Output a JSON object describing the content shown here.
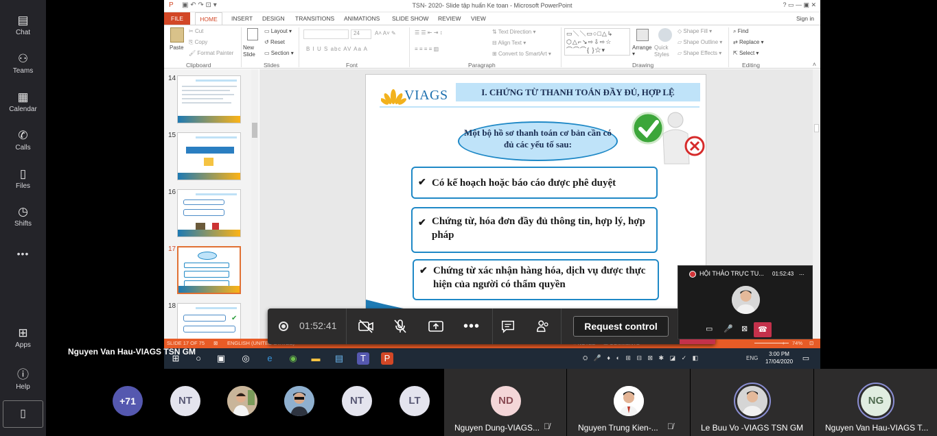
{
  "rail": {
    "items": [
      {
        "label": "Chat",
        "icon": "chat-icon",
        "glyph": "▤"
      },
      {
        "label": "Teams",
        "icon": "teams-icon",
        "glyph": "⚇"
      },
      {
        "label": "Calendar",
        "icon": "calendar-icon",
        "glyph": "▦"
      },
      {
        "label": "Calls",
        "icon": "phone-icon",
        "glyph": "✆"
      },
      {
        "label": "Files",
        "icon": "file-icon",
        "glyph": "▯"
      },
      {
        "label": "Shifts",
        "icon": "clock-icon",
        "glyph": "◷"
      },
      {
        "label": "",
        "icon": "more-icon",
        "glyph": "•••"
      }
    ],
    "apps": "Apps",
    "help": "Help"
  },
  "ppt": {
    "title": "TSN- 2020- Slide tập huấn Ke toan - Microsoft PowerPoint",
    "window_buttons": "?   ▭   —   ▣   ✕",
    "sign_in": "Sign in",
    "tabs": [
      "FILE",
      "HOME",
      "INSERT",
      "DESIGN",
      "TRANSITIONS",
      "ANIMATIONS",
      "SLIDE SHOW",
      "REVIEW",
      "VIEW"
    ],
    "groups": [
      "Clipboard",
      "Slides",
      "Font",
      "Paragraph",
      "Drawing",
      "Editing"
    ],
    "clipboard": {
      "paste": "Paste",
      "cut": "Cut",
      "copy": "Copy",
      "format_painter": "Format Painter"
    },
    "slides": {
      "new_slide": "New Slide",
      "layout": "Layout",
      "reset": "Reset",
      "section": "Section"
    },
    "font": {
      "size": "24",
      "buttons": "B  I  U  S  abc  AV  Aa  A"
    },
    "paragraph": {
      "text_direction": "Text Direction",
      "align_text": "Align Text",
      "smartart": "Convert to SmartArt"
    },
    "drawing": {
      "arrange": "Arrange",
      "quick_styles": "Quick Styles",
      "shape_fill": "Shape Fill",
      "shape_outline": "Shape Outline",
      "shape_effects": "Shape Effects"
    },
    "editing": {
      "find": "Find",
      "replace": "Replace",
      "select": "Select"
    },
    "thumb_numbers": [
      "14",
      "15",
      "16",
      "17",
      "18"
    ],
    "status": {
      "slide": "SLIDE 17 OF 75",
      "lang": "ENGLISH (UNITED STATES)",
      "notes": "NOTES",
      "comments": "COMMENTS",
      "zoom": "74%"
    }
  },
  "slide": {
    "logo": "VIAGS",
    "header": "I. CHỨNG TỪ THANH TOÁN ĐẦY ĐỦ, HỢP LỆ",
    "oval": "Một bộ hồ sơ thanh toán cơ bản cần có đủ các yếu tố sau:",
    "items": [
      "Có kế hoạch hoặc báo cáo được phê duyệt",
      "Chứng từ, hóa đơn đầy đủ thông tin, hợp lý, hợp pháp",
      "Chứng từ xác nhận hàng hóa, dịch vụ được thực hiện của người có thẩm quyền"
    ]
  },
  "taskbar": {
    "time": "3:00 PM",
    "date": "17/04/2020",
    "lang": "ENG"
  },
  "controls": {
    "timer": "01:52:41",
    "request_control": "Request control"
  },
  "mini": {
    "title": "HỘI THẢO TRỰC TU...",
    "timer": "01:52:43",
    "more": "..."
  },
  "presenter_name": "Nguyen Van Hau-VIAGS TSN GM",
  "participants": {
    "overflow": "+71",
    "avatars": [
      "NT",
      "NT",
      "LT"
    ],
    "tiles": [
      {
        "initials": "ND",
        "name": "Nguyen Dung-VIAGS..."
      },
      {
        "initials": "",
        "name": "Nguyen Trung Kien-..."
      },
      {
        "initials": "",
        "name": "Le Buu Vo -VIAGS TSN GM"
      },
      {
        "initials": "NG",
        "name": "Nguyen Van Hau-VIAGS T..."
      }
    ]
  },
  "colors": {
    "teams_rail": "#242429",
    "ppt_accent": "#d24726",
    "slide_blue": "#1e88c6",
    "slide_light": "#bfe3f9",
    "hangup": "#c4314b"
  }
}
